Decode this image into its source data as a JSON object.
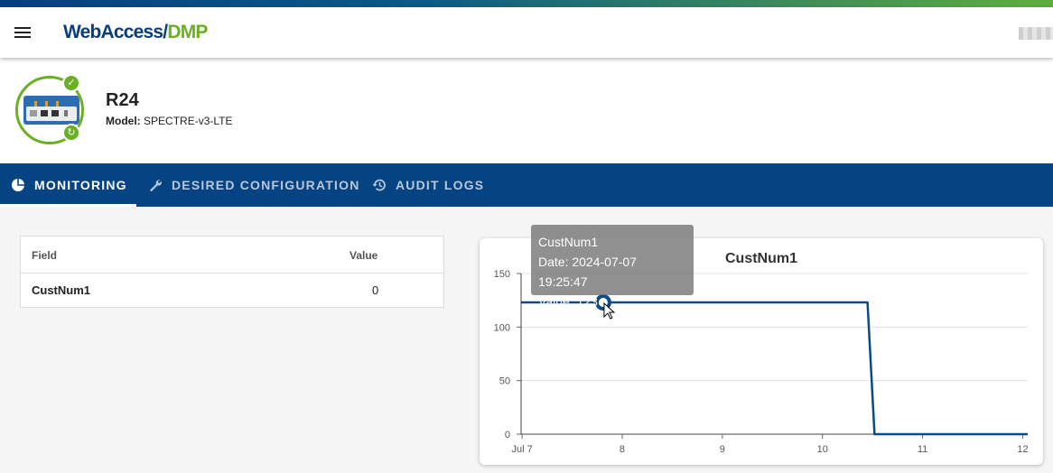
{
  "header": {
    "brand_part1": "WebAccess/",
    "brand_part2": "DMP",
    "menu_icon": "hamburger-menu-icon"
  },
  "device": {
    "name": "R24",
    "model_label": "Model:",
    "model_value": "SPECTRE-v3-LTE",
    "status_icon": "check-circle-icon",
    "sync_icon": "sync-icon"
  },
  "tabs": [
    {
      "label": "MONITORING",
      "icon": "pie-chart-icon",
      "active": true
    },
    {
      "label": "DESIRED CONFIGURATION",
      "icon": "wrench-icon",
      "active": false
    },
    {
      "label": "AUDIT LOGS",
      "icon": "history-icon",
      "active": false
    }
  ],
  "field_table": {
    "columns": [
      "Field",
      "Value"
    ],
    "rows": [
      {
        "field": "CustNum1",
        "value": "0"
      }
    ]
  },
  "tooltip": {
    "title": "CustNum1",
    "date": "Date: 2024-07-07 19:25:47",
    "value": "Value: 123"
  },
  "colors": {
    "accent_blue": "#064383",
    "brand_green": "#6ab023",
    "line": "#0a4a86"
  },
  "chart_data": {
    "type": "line",
    "title": "CustNum1",
    "xlabel": "",
    "ylabel": "",
    "x_tick_labels": [
      "Jul 7",
      "8",
      "9",
      "10",
      "11",
      "12"
    ],
    "x_ticks": [
      7,
      8,
      9,
      10,
      11,
      12
    ],
    "xlim": [
      6.99,
      12.05
    ],
    "ylim": [
      0,
      150
    ],
    "y_ticks": [
      0,
      50,
      100,
      150
    ],
    "grid": true,
    "series": [
      {
        "name": "CustNum1",
        "x": [
          6.99,
          7.81,
          10.45,
          10.52,
          12.05
        ],
        "y": [
          123,
          123,
          123,
          0,
          0
        ]
      }
    ],
    "highlight_point": {
      "x": 7.81,
      "y": 123
    }
  }
}
